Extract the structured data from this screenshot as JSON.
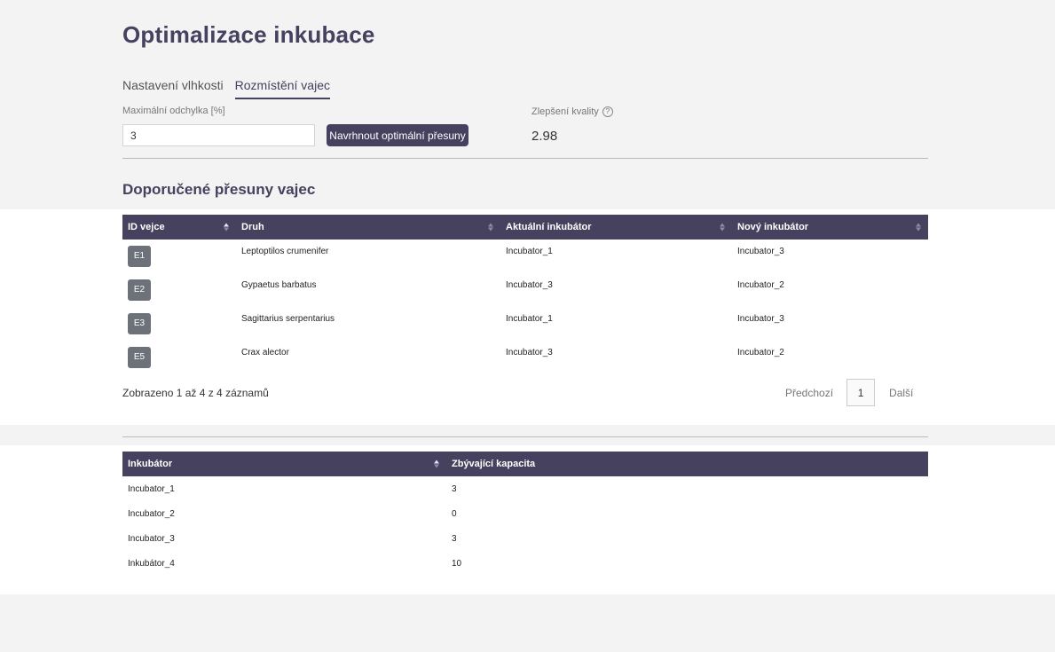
{
  "page": {
    "title": "Optimalizace inkubace"
  },
  "tabs": [
    {
      "label": "Nastavení vlhkosti",
      "active": false
    },
    {
      "label": "Rozmístění vajec",
      "active": true
    }
  ],
  "form": {
    "deviation_label": "Maximální odchylka [%]",
    "deviation_value": "3",
    "suggest_button": "Navrhnout optimální přesuny",
    "quality_label": "Zlepšení kvality",
    "quality_help": "?",
    "quality_value": "2.98"
  },
  "moves": {
    "title": "Doporučené přesuny vajec",
    "columns": [
      "ID vejce",
      "Druh",
      "Aktuální inkubátor",
      "Nový inkubátor"
    ],
    "rows": [
      {
        "id": "E1",
        "species": "Leptoptilos crumenifer",
        "current": "Incubator_1",
        "new": "Incubator_3"
      },
      {
        "id": "E2",
        "species": "Gypaetus barbatus",
        "current": "Incubator_3",
        "new": "Incubator_2"
      },
      {
        "id": "E3",
        "species": "Sagittarius serpentarius",
        "current": "Incubator_1",
        "new": "Incubator_3"
      },
      {
        "id": "E5",
        "species": "Crax alector",
        "current": "Incubator_3",
        "new": "Incubator_2"
      }
    ],
    "info": "Zobrazeno 1 až 4 z 4 záznamů",
    "pagination": {
      "prev": "Předchozí",
      "page": "1",
      "next": "Další"
    }
  },
  "capacity": {
    "columns": [
      "Inkubátor",
      "Zbývající kapacita"
    ],
    "rows": [
      {
        "name": "Incubator_1",
        "capacity": "3"
      },
      {
        "name": "Incubator_2",
        "capacity": "0"
      },
      {
        "name": "Incubator_3",
        "capacity": "3"
      },
      {
        "name": "Inkubátor_4",
        "capacity": "10"
      }
    ]
  },
  "colors": {
    "accent": "#45415f",
    "badge": "#6c717a",
    "background": "#f3f3f3"
  }
}
